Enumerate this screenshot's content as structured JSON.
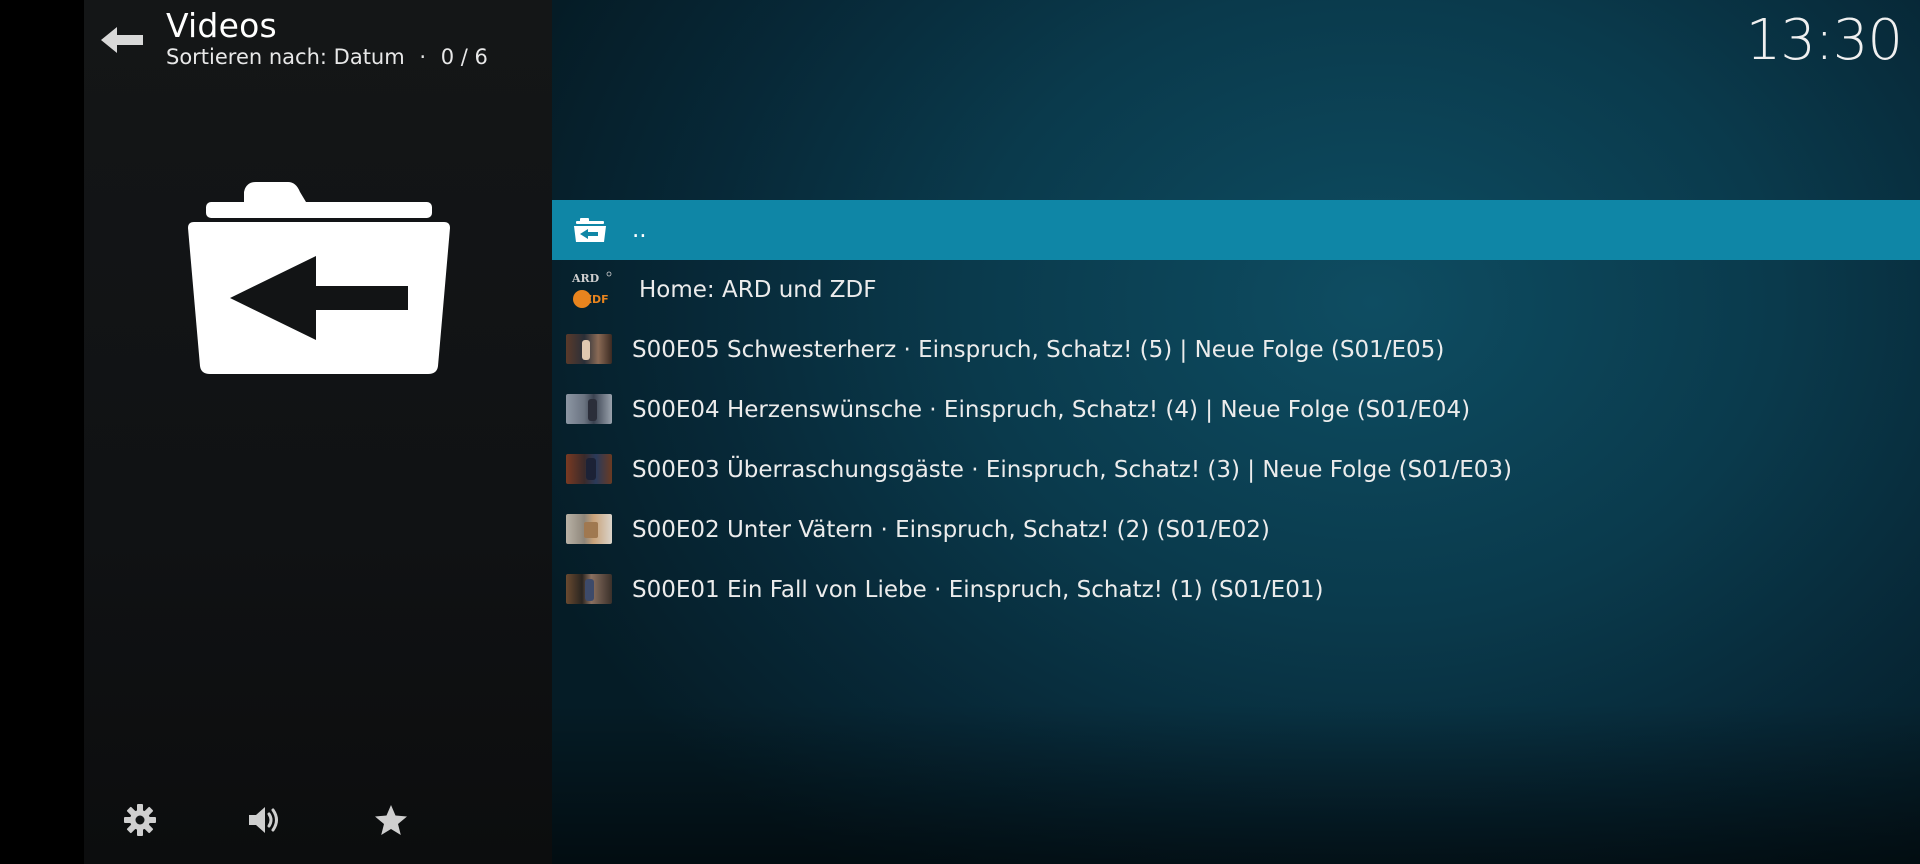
{
  "header": {
    "title": "Videos",
    "sort_label": "Sortieren nach: Datum",
    "separator": "·",
    "position": "0 / 6"
  },
  "clock": "13:30",
  "list": {
    "parent_label": "..",
    "items": [
      {
        "label": "Home: ARD und ZDF",
        "icon": "ard-zdf-logo"
      },
      {
        "label": "S00E05 Schwesterherz · Einspruch, Schatz! (5) | Neue Folge (S01/E05)",
        "icon": "episode-thumbnail"
      },
      {
        "label": "S00E04 Herzenswünsche · Einspruch, Schatz! (4) | Neue Folge (S01/E04)",
        "icon": "episode-thumbnail"
      },
      {
        "label": "S00E03 Überraschungsgäste · Einspruch, Schatz! (3) | Neue Folge (S01/E03)",
        "icon": "episode-thumbnail"
      },
      {
        "label": "S00E02 Unter Vätern · Einspruch, Schatz! (2) (S01/E02)",
        "icon": "episode-thumbnail"
      },
      {
        "label": "S00E01 Ein Fall von Liebe · Einspruch, Schatz! (1) (S01/E01)",
        "icon": "episode-thumbnail"
      }
    ]
  },
  "logo_text": {
    "ard": "ARD",
    "zdf": "ZDF"
  },
  "colors": {
    "selected_row": "#0f86a6",
    "accent_orange": "#e8841e"
  },
  "bottom_icons": [
    "settings-gear-icon",
    "volume-icon",
    "favourites-star-icon"
  ]
}
